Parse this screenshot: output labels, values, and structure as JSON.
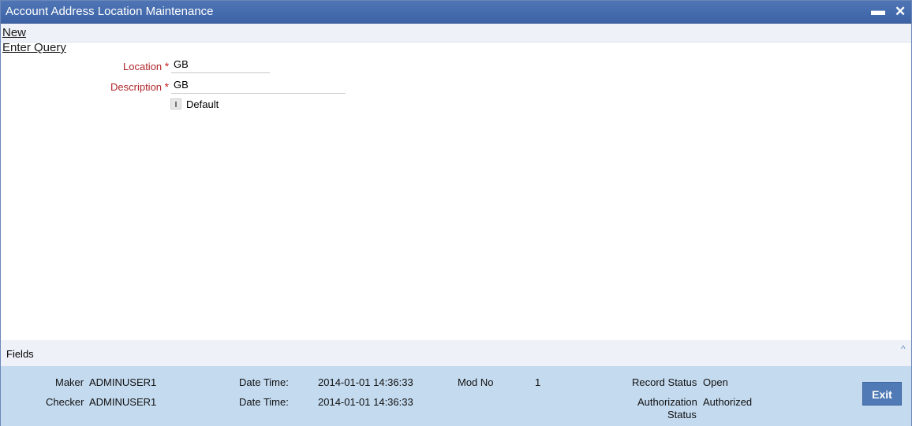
{
  "window": {
    "title": "Account Address Location Maintenance",
    "minimize_glyph": "▬",
    "close_glyph": "✕"
  },
  "toolbar": {
    "new_label": "New",
    "enter_query_label": "Enter Query"
  },
  "form": {
    "location": {
      "label": "Location",
      "required": "*",
      "value": "GB"
    },
    "description": {
      "label": "Description",
      "required": "*",
      "value": "GB"
    },
    "default": {
      "label": "Default",
      "checked": false
    }
  },
  "fields_section": {
    "label": "Fields",
    "collapse_glyph": "^"
  },
  "audit": {
    "maker_label": "Maker",
    "maker_value": "ADMINUSER1",
    "maker_dt_label": "Date Time:",
    "maker_dt_value": "2014-01-01 14:36:33",
    "mod_no_label": "Mod No",
    "mod_no_value": "1",
    "record_status_label": "Record Status",
    "record_status_value": "Open",
    "checker_label": "Checker",
    "checker_value": "ADMINUSER1",
    "checker_dt_label": "Date Time:",
    "checker_dt_value": "2014-01-01 14:36:33",
    "auth_status_label_1": "Authorization",
    "auth_status_label_2": "Status",
    "auth_status_value": "Authorized"
  },
  "exit_label": "Exit"
}
